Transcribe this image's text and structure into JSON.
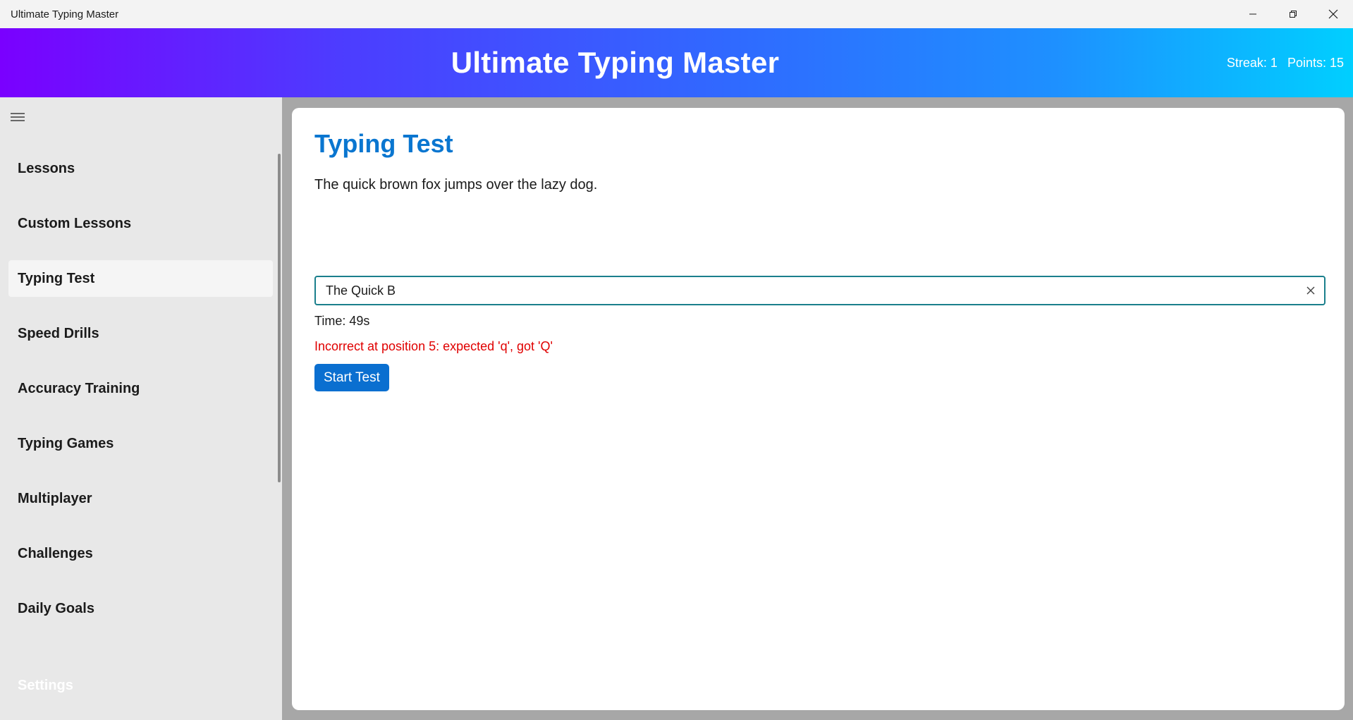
{
  "window": {
    "title": "Ultimate Typing Master",
    "controls": [
      "minimize-icon",
      "restore-icon",
      "close-icon"
    ]
  },
  "header": {
    "title": "Ultimate Typing Master",
    "streak": "Streak: 1",
    "points": "Points: 15"
  },
  "sidebar": {
    "menu_icon": "hamburger-icon",
    "items": [
      {
        "label": "Lessons"
      },
      {
        "label": "Custom Lessons"
      },
      {
        "label": "Typing Test",
        "active": true
      },
      {
        "label": "Speed Drills"
      },
      {
        "label": "Accuracy Training"
      },
      {
        "label": "Typing Games"
      },
      {
        "label": "Multiplayer"
      },
      {
        "label": "Challenges"
      },
      {
        "label": "Daily Goals"
      }
    ],
    "settings_label": "Settings"
  },
  "main": {
    "title": "Typing Test",
    "sample_text": "The quick brown fox jumps over the lazy dog.",
    "input_value": "The Quick B",
    "timer": "Time: 49s",
    "error_message": "Incorrect at position 5: expected 'q', got 'Q'",
    "start_button": "Start Test"
  },
  "colors": {
    "accent": "#0a76d0",
    "error": "#e00000",
    "input_border": "#1a7f8c",
    "gradient_start": "#7a00ff",
    "gradient_end": "#00cfff"
  }
}
